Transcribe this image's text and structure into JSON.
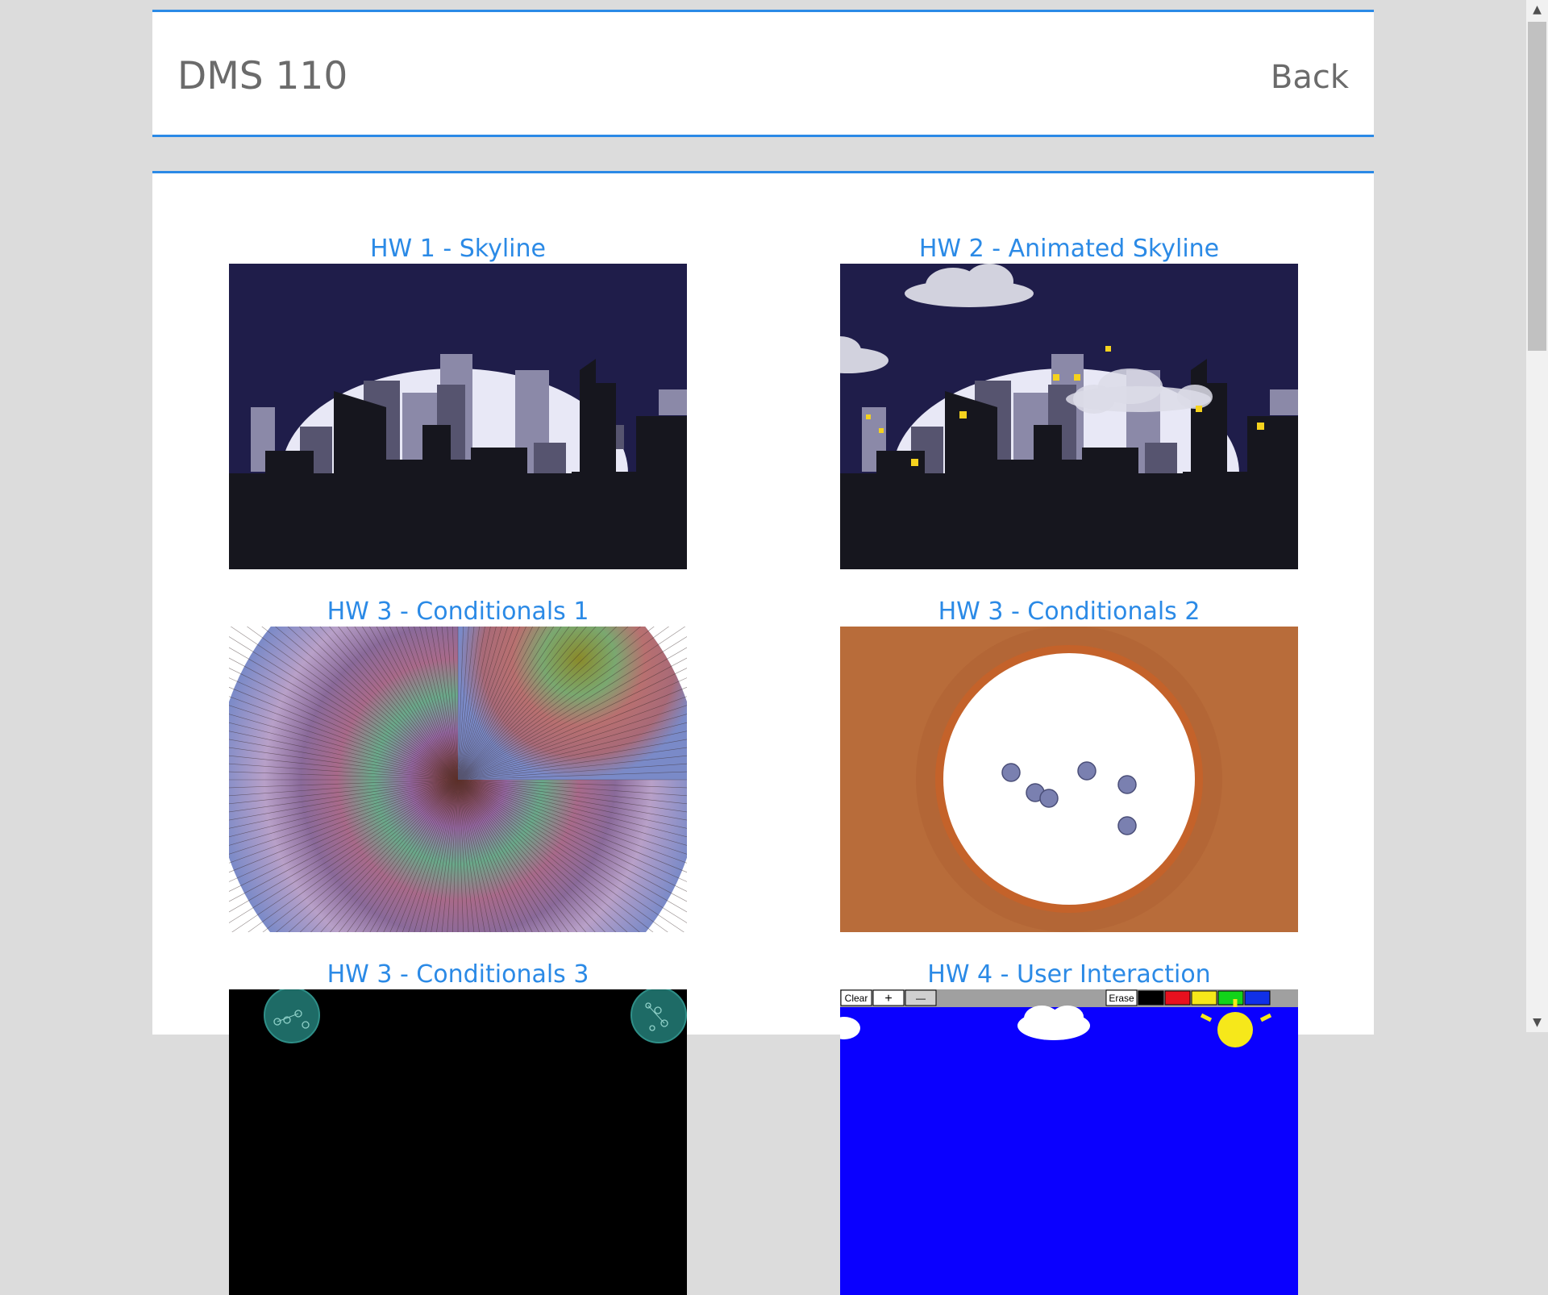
{
  "header": {
    "title": "DMS 110",
    "back_label": "Back"
  },
  "projects": [
    {
      "title": "HW 1 - Skyline",
      "thumbnail": "skyline"
    },
    {
      "title": "HW 2 - Animated Skyline",
      "thumbnail": "animated-skyline"
    },
    {
      "title": "HW 3 - Conditionals 1",
      "thumbnail": "radial-lines"
    },
    {
      "title": "HW 3 - Conditionals 2",
      "thumbnail": "circle-with-dots"
    },
    {
      "title": "HW 3 - Conditionals 3",
      "thumbnail": "black-with-bubbles"
    },
    {
      "title": "HW 4 - User Interaction",
      "thumbnail": "paint-program"
    }
  ],
  "paint_toolbar": {
    "clear_label": "Clear",
    "plus_label": "+",
    "minus_label": "—",
    "erase_label": "Erase",
    "swatches": [
      "#000000",
      "#e8101e",
      "#f6e81a",
      "#12d41a",
      "#1030e8"
    ]
  },
  "colors": {
    "accent": "#2b8ae6",
    "night_sky": "#1f1d4a",
    "building_dark": "#16161e",
    "moon": "#e8e8f6",
    "terracotta": "#b86c3a"
  }
}
